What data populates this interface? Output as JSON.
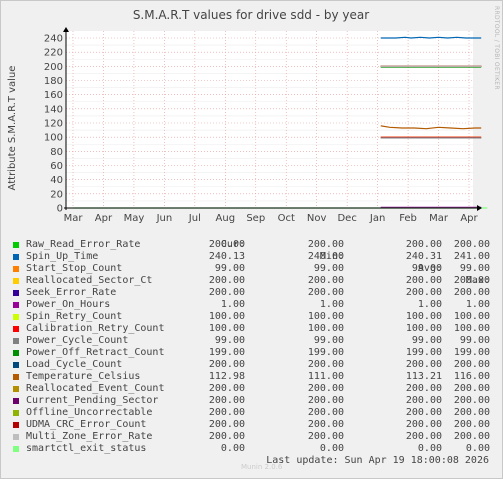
{
  "side_credit": "RRDTOOL / TOBI OETIKER",
  "watermark": "Munin 2.0.6",
  "last_update": "Last update:  Sun Apr 19 18:00:08 2026",
  "legend_headers": {
    "cur": "Cur:",
    "min": "Min:",
    "avg": "Avg:",
    "max": "Max:"
  },
  "legend": [
    {
      "name": "Raw_Read_Error_Rate",
      "color": "#00cc00",
      "cur": "200.00",
      "min": "200.00",
      "avg": "200.00",
      "max": "200.00"
    },
    {
      "name": "Spin_Up_Time",
      "color": "#0066b3",
      "cur": "240.13",
      "min": "240.00",
      "avg": "240.31",
      "max": "241.00"
    },
    {
      "name": "Start_Stop_Count",
      "color": "#ff8000",
      "cur": "99.00",
      "min": "99.00",
      "avg": "99.00",
      "max": "99.00"
    },
    {
      "name": "Reallocated_Sector_Ct",
      "color": "#ffcc00",
      "cur": "200.00",
      "min": "200.00",
      "avg": "200.00",
      "max": "200.00"
    },
    {
      "name": "Seek_Error_Rate",
      "color": "#330099",
      "cur": "200.00",
      "min": "200.00",
      "avg": "200.00",
      "max": "200.00"
    },
    {
      "name": "Power_On_Hours",
      "color": "#990099",
      "cur": "1.00",
      "min": "1.00",
      "avg": "1.00",
      "max": "1.00"
    },
    {
      "name": "Spin_Retry_Count",
      "color": "#ccff00",
      "cur": "100.00",
      "min": "100.00",
      "avg": "100.00",
      "max": "100.00"
    },
    {
      "name": "Calibration_Retry_Count",
      "color": "#ff0000",
      "cur": "100.00",
      "min": "100.00",
      "avg": "100.00",
      "max": "100.00"
    },
    {
      "name": "Power_Cycle_Count",
      "color": "#808080",
      "cur": "99.00",
      "min": "99.00",
      "avg": "99.00",
      "max": "99.00"
    },
    {
      "name": "Power_Off_Retract_Count",
      "color": "#008f00",
      "cur": "199.00",
      "min": "199.00",
      "avg": "199.00",
      "max": "199.00"
    },
    {
      "name": "Load_Cycle_Count",
      "color": "#00487d",
      "cur": "200.00",
      "min": "200.00",
      "avg": "200.00",
      "max": "200.00"
    },
    {
      "name": "Temperature_Celsius",
      "color": "#b35a00",
      "cur": "112.98",
      "min": "111.00",
      "avg": "113.21",
      "max": "116.00"
    },
    {
      "name": "Reallocated_Event_Count",
      "color": "#b38f00",
      "cur": "200.00",
      "min": "200.00",
      "avg": "200.00",
      "max": "200.00"
    },
    {
      "name": "Current_Pending_Sector",
      "color": "#6b006b",
      "cur": "200.00",
      "min": "200.00",
      "avg": "200.00",
      "max": "200.00"
    },
    {
      "name": "Offline_Uncorrectable",
      "color": "#8fb300",
      "cur": "200.00",
      "min": "200.00",
      "avg": "200.00",
      "max": "200.00"
    },
    {
      "name": "UDMA_CRC_Error_Count",
      "color": "#b30000",
      "cur": "200.00",
      "min": "200.00",
      "avg": "200.00",
      "max": "200.00"
    },
    {
      "name": "Multi_Zone_Error_Rate",
      "color": "#bebebe",
      "cur": "200.00",
      "min": "200.00",
      "avg": "200.00",
      "max": "200.00"
    },
    {
      "name": "smartctl_exit_status",
      "color": "#80ff80",
      "cur": "0.00",
      "min": "0.00",
      "avg": "0.00",
      "max": "0.00"
    }
  ],
  "chart_data": {
    "type": "line",
    "title": "S.M.A.R.T values for drive sdd - by year",
    "ylabel": "Attribute S.M.A.R.T value",
    "xlabel": "",
    "x_ticks": [
      "Mar",
      "Apr",
      "May",
      "Jun",
      "Jul",
      "Aug",
      "Sep",
      "Oct",
      "Nov",
      "Dec",
      "Jan",
      "Feb",
      "Mar",
      "Apr"
    ],
    "y_ticks": [
      0,
      20,
      40,
      60,
      80,
      100,
      120,
      140,
      160,
      180,
      200,
      220,
      240
    ],
    "ylim": [
      0,
      255
    ],
    "xlim": [
      0,
      13.6
    ],
    "grid": true,
    "series": [
      {
        "name": "Raw_Read_Error_Rate",
        "color": "#00cc00",
        "x": [
          10.1,
          13.4
        ],
        "y": [
          200,
          200
        ]
      },
      {
        "name": "Spin_Up_Time",
        "color": "#0066b3",
        "x": [
          10.1,
          10.6,
          10.9,
          11.1,
          11.4,
          11.7,
          12.0,
          12.3,
          12.6,
          12.9,
          13.2,
          13.4
        ],
        "y": [
          240,
          240,
          241,
          240,
          241,
          240,
          241,
          240,
          241,
          240,
          240,
          240
        ]
      },
      {
        "name": "Start_Stop_Count",
        "color": "#ff8000",
        "x": [
          10.1,
          13.4
        ],
        "y": [
          99,
          99
        ]
      },
      {
        "name": "Reallocated_Sector_Ct",
        "color": "#ffcc00",
        "x": [
          10.1,
          13.4
        ],
        "y": [
          200,
          200
        ]
      },
      {
        "name": "Seek_Error_Rate",
        "color": "#330099",
        "x": [
          10.1,
          13.4
        ],
        "y": [
          200,
          200
        ]
      },
      {
        "name": "Power_On_Hours",
        "color": "#990099",
        "x": [
          10.1,
          13.4
        ],
        "y": [
          1,
          1
        ]
      },
      {
        "name": "Spin_Retry_Count",
        "color": "#ccff00",
        "x": [
          10.1,
          13.4
        ],
        "y": [
          100,
          100
        ]
      },
      {
        "name": "Calibration_Retry_Count",
        "color": "#ff0000",
        "x": [
          10.1,
          13.4
        ],
        "y": [
          100,
          100
        ]
      },
      {
        "name": "Power_Cycle_Count",
        "color": "#808080",
        "x": [
          10.1,
          13.4
        ],
        "y": [
          99,
          99
        ]
      },
      {
        "name": "Power_Off_Retract_Count",
        "color": "#008f00",
        "x": [
          10.1,
          13.4
        ],
        "y": [
          199,
          199
        ]
      },
      {
        "name": "Load_Cycle_Count",
        "color": "#00487d",
        "x": [
          10.1,
          13.4
        ],
        "y": [
          200,
          200
        ]
      },
      {
        "name": "Temperature_Celsius",
        "color": "#b35a00",
        "x": [
          10.1,
          10.4,
          10.8,
          11.2,
          11.6,
          12.0,
          12.4,
          12.8,
          13.2,
          13.4
        ],
        "y": [
          116,
          114,
          113,
          113,
          112,
          114,
          113,
          112,
          113,
          113
        ]
      },
      {
        "name": "Reallocated_Event_Count",
        "color": "#b38f00",
        "x": [
          10.1,
          13.4
        ],
        "y": [
          200,
          200
        ]
      },
      {
        "name": "Current_Pending_Sector",
        "color": "#6b006b",
        "x": [
          10.1,
          13.4
        ],
        "y": [
          200,
          200
        ]
      },
      {
        "name": "Offline_Uncorrectable",
        "color": "#8fb300",
        "x": [
          10.1,
          13.4
        ],
        "y": [
          200,
          200
        ]
      },
      {
        "name": "UDMA_CRC_Error_Count",
        "color": "#b30000",
        "x": [
          10.1,
          13.4
        ],
        "y": [
          200,
          200
        ]
      },
      {
        "name": "Multi_Zone_Error_Rate",
        "color": "#bebebe",
        "x": [
          10.1,
          13.4
        ],
        "y": [
          200,
          200
        ]
      },
      {
        "name": "smartctl_exit_status",
        "color": "#80ff80",
        "x": [
          0,
          13.6
        ],
        "y": [
          0,
          0
        ]
      }
    ]
  }
}
